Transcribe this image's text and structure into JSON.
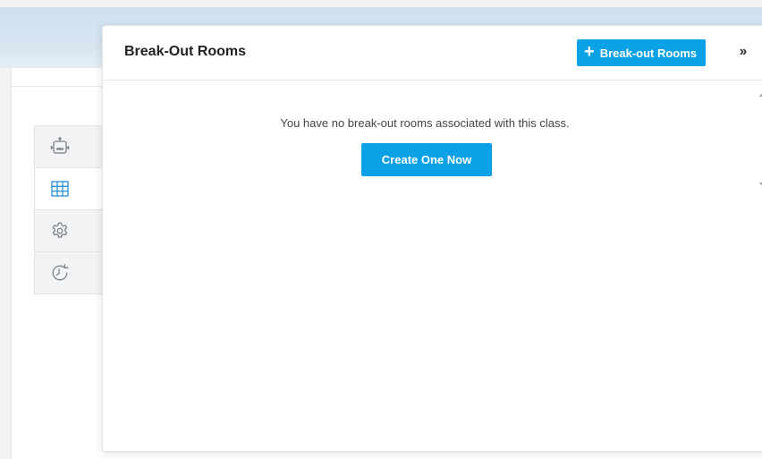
{
  "panel": {
    "title": "Break-Out Rooms",
    "add_button_label": "Break-out Rooms",
    "add_button_icon": "plus-icon",
    "collapse_icon": "double-chevron-right-icon",
    "empty_message": "You have no break-out rooms associated with this class.",
    "create_button_label": "Create One Now"
  },
  "toolstrip": {
    "items": [
      {
        "icon": "robot-icon",
        "active": false
      },
      {
        "icon": "grid-icon",
        "active": true
      },
      {
        "icon": "gear-icon",
        "active": false
      },
      {
        "icon": "history-icon",
        "active": false
      }
    ]
  },
  "colors": {
    "accent": "#0aa1e6",
    "active_icon": "#2a90d8",
    "inactive_icon": "#7a7f85",
    "header_gradient": "#d7e5f1"
  }
}
